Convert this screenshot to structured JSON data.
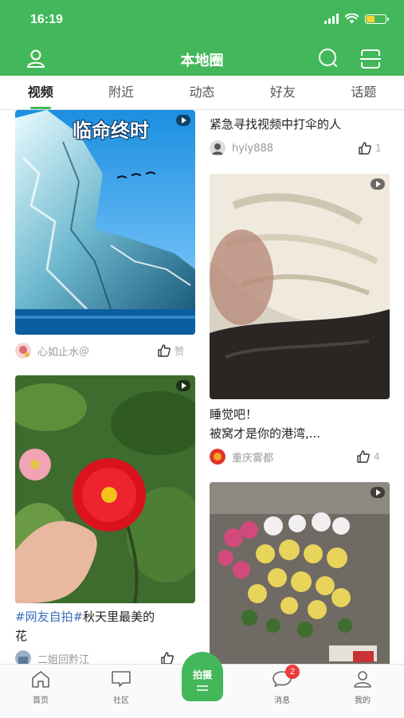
{
  "status_bar": {
    "time": "16:19"
  },
  "header": {
    "title": "本地圈"
  },
  "tabs": [
    {
      "label": "视频",
      "active": true
    },
    {
      "label": "附近",
      "active": false
    },
    {
      "label": "动态",
      "active": false
    },
    {
      "label": "好友",
      "active": false
    },
    {
      "label": "话题",
      "active": false
    }
  ],
  "feed": {
    "left": [
      {
        "title": "",
        "author": "心如止水＠",
        "likes": "赞",
        "thumb_text": "临命终时"
      },
      {
        "title": "#网友自拍#秋天里最美的花",
        "title_line1": "#网友自拍#秋天里最美的",
        "title_line2": "花",
        "author": "二姐回黔江",
        "likes": ""
      }
    ],
    "right": [
      {
        "title": "紧急寻找视频中打伞的人",
        "author": "hyly888",
        "likes": "1"
      },
      {
        "title": "睡觉吧！被窝才是你的港湾,...",
        "title_line1": "睡觉吧！",
        "title_line2": "被窝才是你的港湾,...",
        "author": "重庆雾都",
        "likes": "4"
      },
      {
        "title": "",
        "author": "",
        "likes": ""
      }
    ]
  },
  "bottom_nav": {
    "items": [
      {
        "label": "首页",
        "icon": "home-icon"
      },
      {
        "label": "社区",
        "icon": "community-icon"
      },
      {
        "label": "拍摄",
        "icon": "shoot-icon"
      },
      {
        "label": "消息",
        "icon": "message-icon",
        "badge": "2"
      },
      {
        "label": "我的",
        "icon": "profile-icon"
      }
    ]
  },
  "colors": {
    "brand": "#43b85a",
    "badge": "#ef3b3b",
    "battery": "#ffd231"
  }
}
